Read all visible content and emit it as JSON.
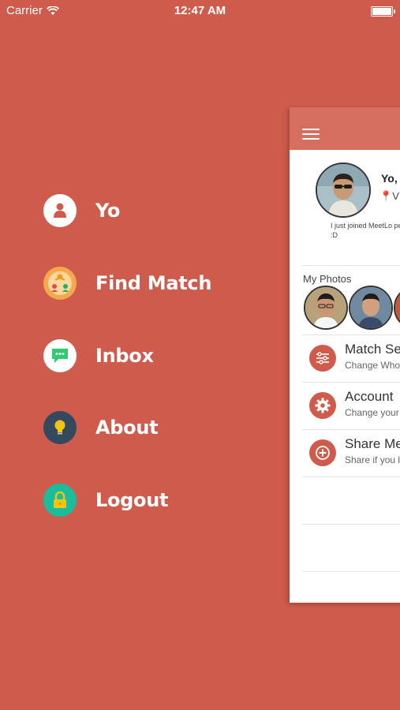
{
  "status_bar": {
    "carrier": "Carrier",
    "time": "12:47 AM"
  },
  "menu": {
    "items": [
      {
        "label": "Yo",
        "icon": "user-icon",
        "color": "#ffffff"
      },
      {
        "label": "Find Match",
        "icon": "match-icon",
        "color": "#f5a94c"
      },
      {
        "label": "Inbox",
        "icon": "chat-icon",
        "color": "#ffffff"
      },
      {
        "label": "About",
        "icon": "lightbulb-icon",
        "color": "#34495e"
      },
      {
        "label": "Logout",
        "icon": "lock-icon",
        "color": "#1abc9c"
      }
    ]
  },
  "card": {
    "header_color": "#d76f61",
    "profile": {
      "greeting": "Yo,",
      "location": "V",
      "bio": "I just joined MeetLo person :D"
    },
    "photos": {
      "title": "My Photos"
    },
    "settings": [
      {
        "title": "Match Se",
        "subtitle": "Change Who",
        "icon": "sliders-icon"
      },
      {
        "title": "Account",
        "subtitle": "Change your",
        "icon": "gear-icon"
      },
      {
        "title": "Share Me",
        "subtitle": "Share if you l",
        "icon": "plus-icon"
      }
    ]
  },
  "colors": {
    "background": "#cf5b4c",
    "accent": "#cf5b4c"
  }
}
